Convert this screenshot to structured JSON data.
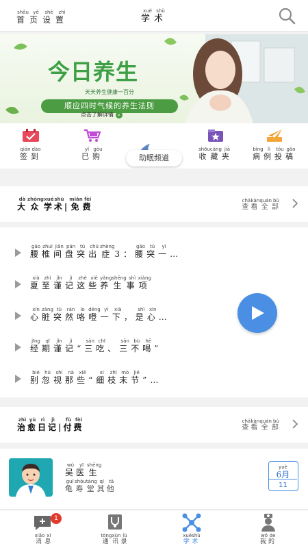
{
  "header": {
    "left": {
      "text": "首页设置",
      "pinyin": [
        "shǒu",
        "yè",
        "shè",
        "zhì"
      ]
    },
    "title": {
      "text": "学术",
      "pinyin": [
        "xué",
        "shù"
      ]
    },
    "search_icon": "search-icon"
  },
  "banner": {
    "headline": "今日养生",
    "tagline": "天天养生健康一百分",
    "subtitle": "顺应四时气候的养生法则",
    "link": "点击了解详情",
    "colors": {
      "green": "#3ea046",
      "pill": "#4b9c42"
    }
  },
  "categories": [
    {
      "label": "签到",
      "pinyin": [
        "qiān",
        "dào"
      ],
      "icon": "calendar-check-icon"
    },
    {
      "label": "已购",
      "pinyin": [
        "yǐ",
        "gòu"
      ],
      "icon": "shopping-cart-icon"
    },
    {
      "label": "收藏夹",
      "pinyin": [
        "shōu",
        "cáng",
        "jiā"
      ],
      "icon": "star-folder-icon"
    },
    {
      "label": "病例投稿",
      "pinyin": [
        "bìng",
        "lì",
        "tóu",
        "gǎo"
      ],
      "icon": "send-icon"
    }
  ],
  "sleep_tab": "助眠频道",
  "section_public": {
    "title": {
      "text": "大众学术|免费",
      "pinyin": [
        "dà",
        "zhòng",
        "xué",
        "shù",
        "",
        "miǎn",
        "fèi"
      ]
    },
    "more": {
      "text": "查看全部",
      "pinyin": [
        "chá",
        "kàn",
        "quán",
        "bù"
      ]
    }
  },
  "articles": [
    {
      "text": "腰椎间盘突出症3：腰突一…",
      "pinyin": [
        "gāo",
        "zhuī",
        "jiān",
        "pán",
        "tū",
        "chū",
        "zhèng",
        "",
        "",
        "gāo",
        "tū",
        "yī",
        ""
      ]
    },
    {
      "text": "夏至谨记这些养生事项",
      "pinyin": [
        "xià",
        "zhì",
        "jǐn",
        "jì",
        "zhè",
        "xiē",
        "yǎng",
        "shēng",
        "shì",
        "xiàng"
      ]
    },
    {
      "text": "心脏突然咯噔一下，是心…",
      "pinyin": [
        "xīn",
        "zàng",
        "tū",
        "rán",
        "lo",
        "dēng",
        "yī",
        "xià",
        "",
        "shì",
        "xīn",
        ""
      ]
    },
    {
      "text": "经期谨记“三吃、三不喝”",
      "pinyin": [
        "jīng",
        "qī",
        "jǐn",
        "jì",
        "",
        "sān",
        "chī",
        "",
        "sān",
        "bù",
        "hē",
        ""
      ]
    },
    {
      "text": "别忽视那些“细枝末节”…",
      "pinyin": [
        "bié",
        "hū",
        "shì",
        "nà",
        "xiē",
        "",
        "xì",
        "zhī",
        "mò",
        "jié",
        "",
        ""
      ]
    }
  ],
  "section_healing": {
    "title": {
      "text": "治愈日记|付费",
      "pinyin": [
        "zhì",
        "yù",
        "rì",
        "jì",
        "",
        "fù",
        "fèi"
      ]
    },
    "more": {
      "text": "查看全部",
      "pinyin": [
        "chá",
        "kàn",
        "quán",
        "bù"
      ]
    }
  },
  "doctor": {
    "name": {
      "text": "吴医生",
      "pinyin": [
        "wú",
        "yī",
        "shēng"
      ]
    },
    "org": {
      "text": "龟寿堂其他",
      "pinyin": [
        "guī",
        "shòu",
        "táng",
        "qí",
        "tā"
      ]
    },
    "month": "6月",
    "month_pinyin": "yuè",
    "day": "11"
  },
  "tabs": [
    {
      "label": "消息",
      "pinyin": [
        "xiāo",
        "xī"
      ],
      "icon": "chat-plus-icon",
      "badge": "1"
    },
    {
      "label": "通讯录",
      "pinyin": [
        "tōng",
        "xùn",
        "lù"
      ],
      "icon": "stethoscope-icon"
    },
    {
      "label": "学术",
      "pinyin": [
        "xué",
        "shù"
      ],
      "icon": "network-icon",
      "active": true
    },
    {
      "label": "我的",
      "pinyin": [
        "wǒ",
        "de"
      ],
      "icon": "nurse-icon"
    }
  ],
  "accent": "#4a8fe3"
}
